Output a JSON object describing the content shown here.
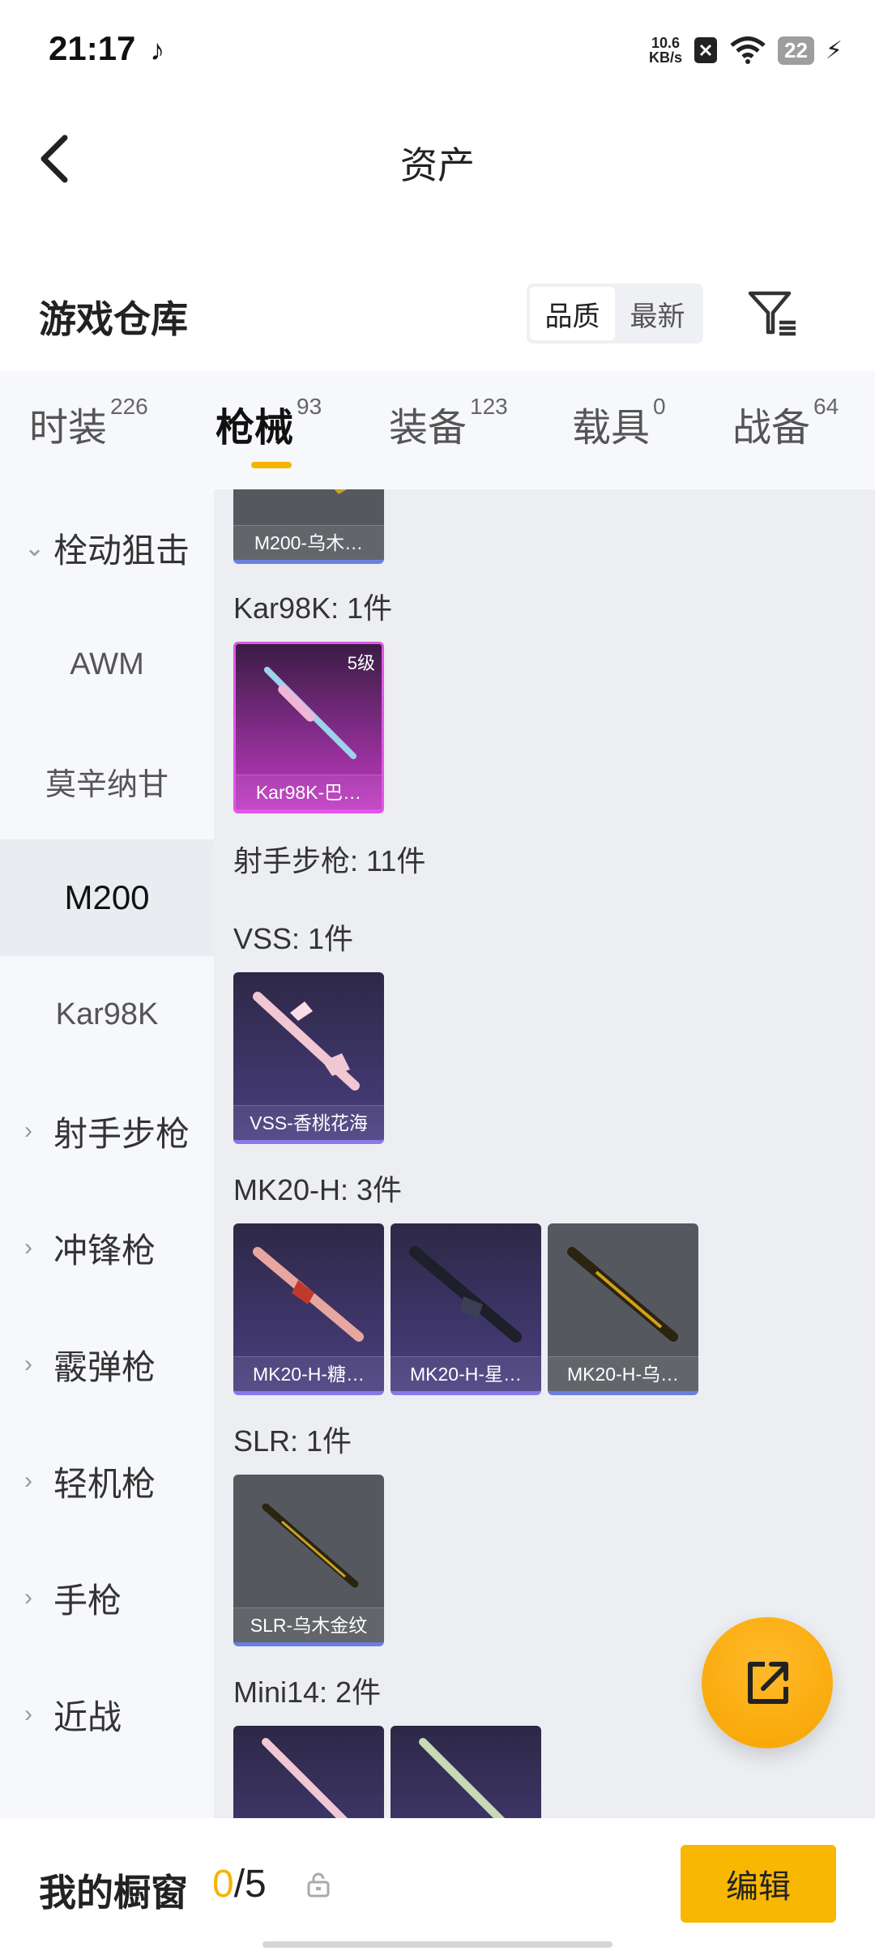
{
  "status": {
    "time": "21:17",
    "speed_value": "10.6",
    "speed_unit": "KB/s",
    "battery": "22"
  },
  "header": {
    "title": "资产"
  },
  "warehouse": {
    "title": "游戏仓库",
    "sort_options": [
      "品质",
      "最新"
    ],
    "sort_selected": "品质"
  },
  "tabs": [
    {
      "label": "时装",
      "count": "226"
    },
    {
      "label": "枪械",
      "count": "93"
    },
    {
      "label": "装备",
      "count": "123"
    },
    {
      "label": "载具",
      "count": "0"
    },
    {
      "label": "战备",
      "count": "64"
    }
  ],
  "sidebar": [
    {
      "label": "栓动狙击",
      "type": "category",
      "expanded": true
    },
    {
      "label": "AWM",
      "type": "sub"
    },
    {
      "label": "莫辛纳甘",
      "type": "sub"
    },
    {
      "label": "M200",
      "type": "sub",
      "active": true
    },
    {
      "label": "Kar98K",
      "type": "sub"
    },
    {
      "label": "射手步枪",
      "type": "category"
    },
    {
      "label": "冲锋枪",
      "type": "category"
    },
    {
      "label": "霰弹枪",
      "type": "category"
    },
    {
      "label": "轻机枪",
      "type": "category"
    },
    {
      "label": "手枪",
      "type": "category"
    },
    {
      "label": "近战",
      "type": "category"
    }
  ],
  "content": {
    "top_card": "M200-乌木…",
    "groups": [
      {
        "label": "Kar98K: 1件",
        "cards": [
          {
            "name": "Kar98K-巴…",
            "level": "5级",
            "style": "pink"
          }
        ]
      },
      {
        "label": "射手步枪: 11件",
        "cards": []
      },
      {
        "label": "VSS: 1件",
        "cards": [
          {
            "name": "VSS-香桃花海",
            "style": "purple"
          }
        ]
      },
      {
        "label": "MK20-H: 3件",
        "cards": [
          {
            "name": "MK20-H-糖…",
            "style": "purple"
          },
          {
            "name": "MK20-H-星…",
            "style": "purple"
          },
          {
            "name": "MK20-H-乌…",
            "style": "grey"
          }
        ]
      },
      {
        "label": "SLR: 1件",
        "cards": [
          {
            "name": "SLR-乌木金纹",
            "style": "grey"
          }
        ]
      },
      {
        "label": "Mini14: 2件",
        "cards": [
          {
            "name": "",
            "style": "purple"
          },
          {
            "name": "",
            "style": "purple"
          }
        ]
      }
    ]
  },
  "showcase": {
    "label": "我的橱窗",
    "current": "0",
    "total": "/5",
    "edit_label": "编辑"
  },
  "colors": {
    "accent": "#f9b701",
    "purple_card": "#4a3e80",
    "pink_card": "#c13ac4",
    "grey_card": "#55595f"
  }
}
